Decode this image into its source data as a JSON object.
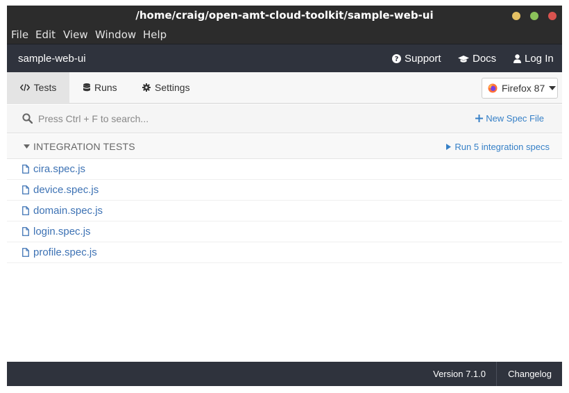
{
  "window": {
    "title": "/home/craig/open-amt-cloud-toolkit/sample-web-ui",
    "controls": [
      {
        "name": "minimize",
        "color": "#e5c164"
      },
      {
        "name": "maximize",
        "color": "#8cc25a"
      },
      {
        "name": "close",
        "color": "#d9534f"
      }
    ]
  },
  "menu": [
    "File",
    "Edit",
    "View",
    "Window",
    "Help"
  ],
  "appnav": {
    "brand": "sample-web-ui",
    "links": [
      {
        "label": "Support",
        "icon": "question-circle-icon"
      },
      {
        "label": "Docs",
        "icon": "graduation-cap-icon"
      },
      {
        "label": "Log In",
        "icon": "user-icon"
      }
    ]
  },
  "tabs": [
    {
      "label": "Tests",
      "icon": "code-icon",
      "active": true
    },
    {
      "label": "Runs",
      "icon": "database-icon",
      "active": false
    },
    {
      "label": "Settings",
      "icon": "cog-icon",
      "active": false
    }
  ],
  "browser": {
    "label": "Firefox 87",
    "icon": "firefox-icon"
  },
  "search": {
    "placeholder": "Press Ctrl + F to search..."
  },
  "new_spec": {
    "label": "New Spec File"
  },
  "group": {
    "title": "INTEGRATION TESTS",
    "run_label": "Run 5 integration specs"
  },
  "specs": [
    "cira.spec.js",
    "device.spec.js",
    "domain.spec.js",
    "login.spec.js",
    "profile.spec.js"
  ],
  "footer": {
    "version": "Version 7.1.0",
    "changelog": "Changelog"
  },
  "colors": {
    "link": "#3680c7",
    "header_bg": "#2f333d",
    "titlebar_bg": "#2c2c2c"
  }
}
